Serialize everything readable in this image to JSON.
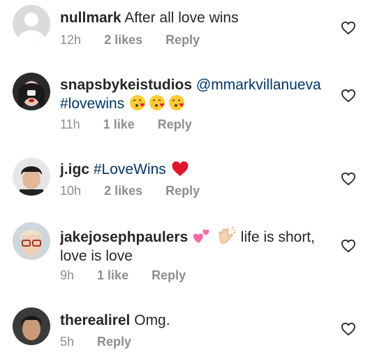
{
  "comments": [
    {
      "user": "nullmark",
      "text": "After all love wins",
      "time": "12h",
      "likes": "2 likes",
      "reply": "Reply"
    },
    {
      "user": "snapsbykeistudios",
      "mention": "@mmarkvillanueva",
      "hashtag": "#lovewins",
      "emoji": "kissing-face x3",
      "time": "11h",
      "likes": "1 like",
      "reply": "Reply"
    },
    {
      "user": "j.igc",
      "hashtag": "#LoveWins",
      "emoji": "red-heart",
      "time": "10h",
      "likes": "2 likes",
      "reply": "Reply"
    },
    {
      "user": "jakejosephpaulers",
      "emoji": "pink-hearts, clapping-hands",
      "text": "life is short,\nlove is love",
      "time": "9h",
      "likes": "1 like",
      "reply": "Reply"
    },
    {
      "user": "therealirel",
      "text": "Omg.",
      "time": "5h",
      "reply": "Reply"
    }
  ],
  "icons": {
    "like": "heart-outline-icon",
    "accent": "#003569",
    "muted": "#8e8e8e"
  }
}
